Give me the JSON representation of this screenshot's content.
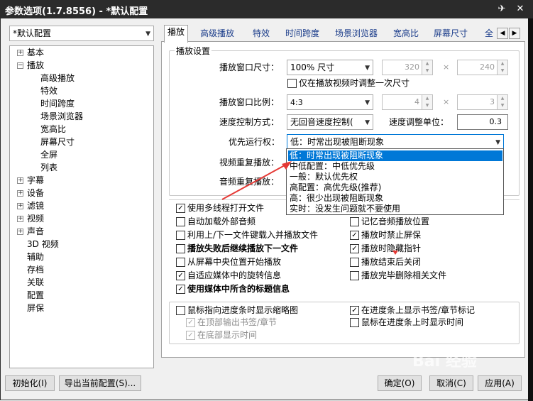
{
  "window": {
    "title": "参数选项(1.7.8556) - *默认配置",
    "pin_glyph": "✈",
    "close_glyph": "✕"
  },
  "profile_combo": "*默认配置",
  "tree": {
    "items": [
      {
        "label": "基本",
        "expander": "+"
      },
      {
        "label": "播放",
        "expander": "−"
      },
      {
        "label": "高级播放"
      },
      {
        "label": "特效"
      },
      {
        "label": "时间跨度"
      },
      {
        "label": "场景浏览器"
      },
      {
        "label": "宽高比"
      },
      {
        "label": "屏幕尺寸"
      },
      {
        "label": "全屏"
      },
      {
        "label": "列表"
      },
      {
        "label": "字幕",
        "expander": "+"
      },
      {
        "label": "设备",
        "expander": "+"
      },
      {
        "label": "滤镜",
        "expander": "+"
      },
      {
        "label": "视频",
        "expander": "+"
      },
      {
        "label": "声音",
        "expander": "+"
      },
      {
        "label": "3D 视频"
      },
      {
        "label": "辅助"
      },
      {
        "label": "存档"
      },
      {
        "label": "关联"
      },
      {
        "label": "配置"
      },
      {
        "label": "屏保"
      }
    ]
  },
  "tabs": [
    "播放",
    "高级播放",
    "特效",
    "时间跨度",
    "场景浏览器",
    "宽高比",
    "屏幕尺寸",
    "全"
  ],
  "tab_arrows": {
    "left": "◀",
    "right": "▶"
  },
  "settings": {
    "group_title": "播放设置",
    "window_size_label": "播放窗口尺寸：",
    "window_size_value": "100% 尺寸",
    "width_value": "320",
    "height_value": "240",
    "times": "×",
    "adjust_once_label": "仅在播放视频时调整一次尺寸",
    "ratio_label": "播放窗口比例：",
    "ratio_value": "4:3",
    "ratio_w": "4",
    "ratio_h": "3",
    "speed_mode_label": "速度控制方式：",
    "speed_mode_value": "无回音速度控制(",
    "speed_unit_label": "速度调整单位：",
    "speed_unit_value": "0.3",
    "priority_label": "优先运行权：",
    "priority_value": "低：时常出现被阻断现象",
    "video_repeat_label": "视频重复播放：",
    "audio_repeat_label": "音频重复播放："
  },
  "priority_options": [
    "低：时常出现被阻断现象",
    "中低配置：中低优先级",
    "一般：默认优先权",
    "高配置：高优先级(推荐)",
    "高：很少出现被阻断现象",
    "实时：没发生问题就不要使用"
  ],
  "checks_left": [
    {
      "label": "使用多线程打开文件",
      "checked": true
    },
    {
      "label": "自动加载外部音频",
      "checked": false
    },
    {
      "label": "利用上/下一文件键载入并播放文件",
      "checked": false
    },
    {
      "label": "播放失败后继续播放下一文件",
      "checked": false,
      "bold": true
    },
    {
      "label": "从屏幕中央位置开始播放",
      "checked": false
    },
    {
      "label": "自适应媒体中的旋转信息",
      "checked": true
    },
    {
      "label": "使用媒体中所含的标题信息",
      "checked": true,
      "bold": true
    }
  ],
  "checks_right": [
    {
      "label": "记忆音频播放位置",
      "checked": false
    },
    {
      "label": "播放时禁止屏保",
      "checked": true
    },
    {
      "label": "播放时隐藏指针",
      "checked": true
    },
    {
      "label": "播放结束后关闭",
      "checked": false
    },
    {
      "label": "播放完毕删除相关文件",
      "checked": false
    }
  ],
  "progress": {
    "thumb_label": "鼠标指向进度条时显示缩略图",
    "top_bookmark_label": "在顶部输出书签/章节",
    "bottom_time_label": "在底部显示时间",
    "show_bookmarks_label": "在进度条上显示书签/章节标记",
    "hover_time_label": "鼠标在进度条上时显示时间"
  },
  "buttons": {
    "init": "初始化(I)",
    "export": "导出当前配置(S)...",
    "ok": "确定(O)",
    "cancel": "取消(C)",
    "apply": "应用(A)"
  },
  "watermark": "Bai 经验"
}
